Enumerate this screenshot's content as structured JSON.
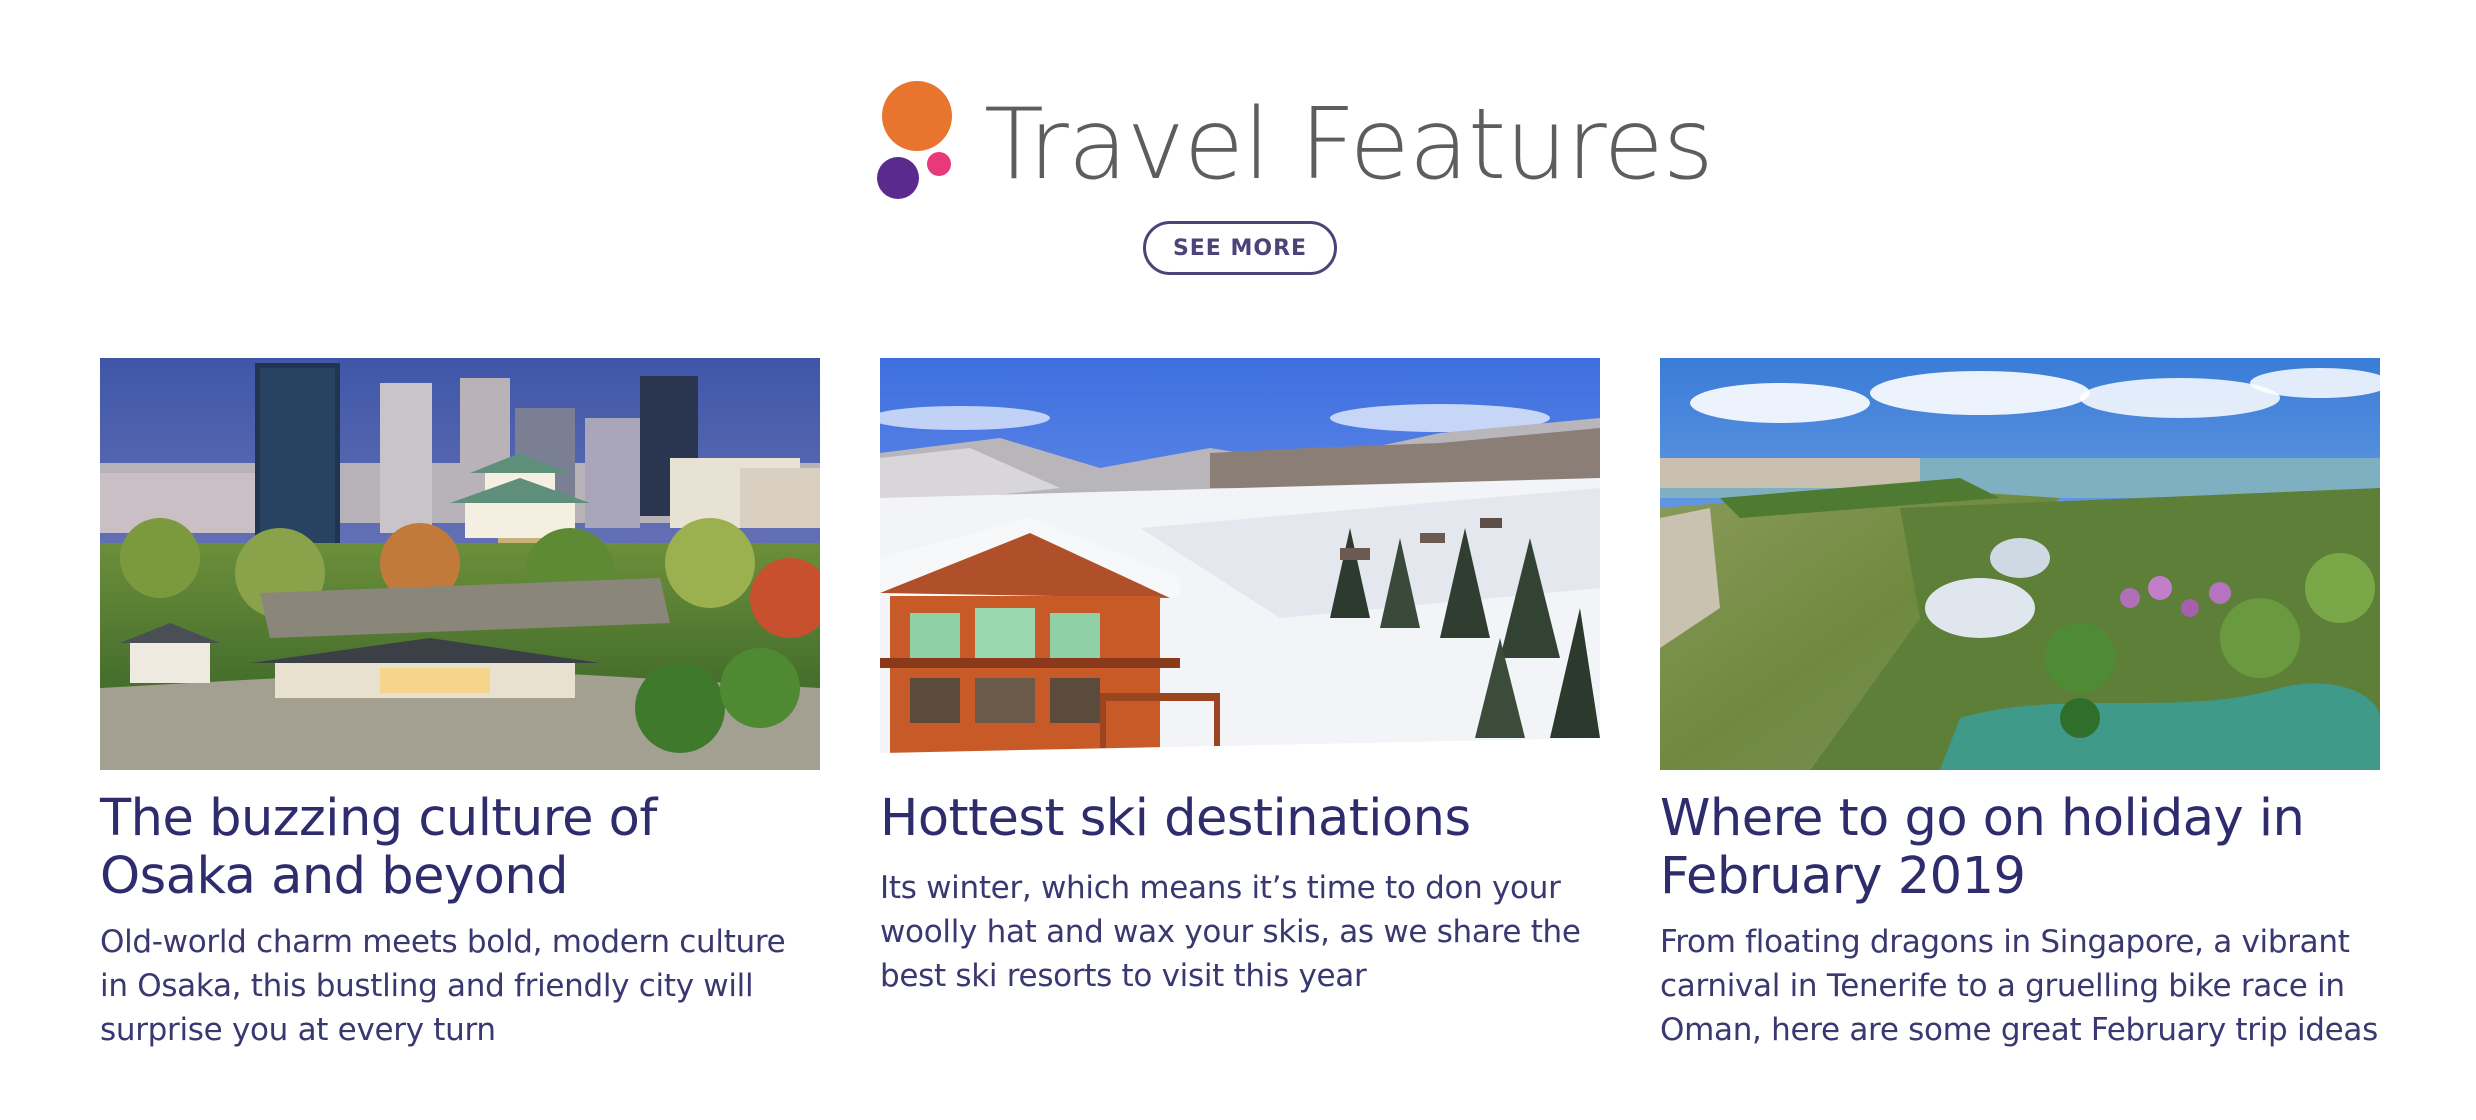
{
  "section": {
    "title": "Travel Features",
    "see_more_label": "SEE MORE",
    "logo_colors": [
      "#e8742e",
      "#e8397a",
      "#5a2a8f"
    ]
  },
  "cards": [
    {
      "title": "The buzzing culture of Osaka and beyond",
      "description": "Old-world charm meets bold, modern culture in Osaka, this bustling and friendly city will surprise you at every turn",
      "image": "osaka-castle-skyline-photo"
    },
    {
      "title": "Hottest ski destinations",
      "description": "Its winter, which means it’s time to don your woolly hat and wax your skis, as we share the best ski resorts to visit this year",
      "image": "snowy-ski-chalet-photo"
    },
    {
      "title": "Where to go on holiday in February 2019",
      "description": "From floating dragons in Singapore, a vibrant carnival in Tenerife to a gruelling bike race in Oman, here are some great February trip ideas",
      "image": "singapore-gardens-aerial-photo"
    }
  ],
  "colors": {
    "title_gray": "#5d5d5d",
    "brand_navy": "#2f2c6e",
    "button_border": "#4a4479"
  }
}
